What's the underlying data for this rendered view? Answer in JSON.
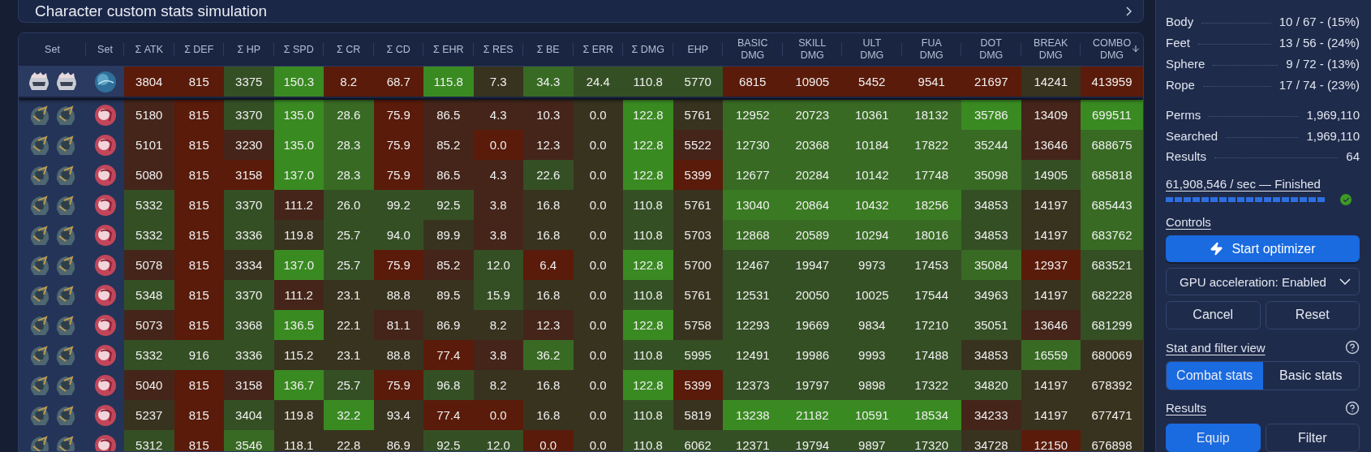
{
  "title_card": {
    "title": "Character custom stats simulation"
  },
  "table": {
    "set_columns": [
      {
        "label": "Set"
      },
      {
        "label": "Set"
      }
    ],
    "columns": [
      {
        "label": "Σ ATK",
        "kind": "stat"
      },
      {
        "label": "Σ DEF",
        "kind": "stat"
      },
      {
        "label": "Σ HP",
        "kind": "stat"
      },
      {
        "label": "Σ SPD",
        "kind": "stat"
      },
      {
        "label": "Σ CR",
        "kind": "stat"
      },
      {
        "label": "Σ CD",
        "kind": "stat"
      },
      {
        "label": "Σ EHR",
        "kind": "stat"
      },
      {
        "label": "Σ RES",
        "kind": "stat"
      },
      {
        "label": "Σ BE",
        "kind": "stat"
      },
      {
        "label": "Σ ERR",
        "kind": "stat"
      },
      {
        "label": "Σ DMG",
        "kind": "stat"
      },
      {
        "label": "EHP",
        "kind": "stat"
      },
      {
        "label": "BASIC DMG",
        "kind": "dmg"
      },
      {
        "label": "SKILL DMG",
        "kind": "dmg"
      },
      {
        "label": "ULT DMG",
        "kind": "dmg"
      },
      {
        "label": "FUA DMG",
        "kind": "dmg"
      },
      {
        "label": "DOT DMG",
        "kind": "dmg"
      },
      {
        "label": "BREAK DMG",
        "kind": "dmg"
      },
      {
        "label": "COMBO DMG",
        "kind": "sorted"
      }
    ],
    "rows": [
      {
        "pinned": true,
        "sets": [
          {
            "kind": "silver-helm"
          },
          {
            "kind": "silver-helm"
          },
          {
            "kind": "blue-orb"
          }
        ],
        "cells": [
          {
            "text": "3804",
            "color": "#5a1b0a"
          },
          {
            "text": "815",
            "color": "#5a1b0a"
          },
          {
            "text": "3375",
            "color": "#354f25"
          },
          {
            "text": "150.3",
            "color": "#3a8a22"
          },
          {
            "text": "8.2",
            "color": "#5a1b0a"
          },
          {
            "text": "68.7",
            "color": "#5a1b0a"
          },
          {
            "text": "115.8",
            "color": "#3a8a22"
          },
          {
            "text": "7.3",
            "color": "#38331f"
          },
          {
            "text": "34.3",
            "color": "#386a24"
          },
          {
            "text": "24.4",
            "color": "#354f25"
          },
          {
            "text": "110.8",
            "color": "#354f25"
          },
          {
            "text": "5770",
            "color": "#354f25"
          },
          {
            "text": "6815",
            "color": "#5a1b0a"
          },
          {
            "text": "10905",
            "color": "#5a1b0a"
          },
          {
            "text": "5452",
            "color": "#5a1b0a"
          },
          {
            "text": "9541",
            "color": "#5a1b0a"
          },
          {
            "text": "21697",
            "color": "#5a1b0a"
          },
          {
            "text": "14241",
            "color": "#38331f"
          },
          {
            "text": "413959",
            "color": "#5a1b0a"
          }
        ]
      },
      {
        "pinned": false,
        "sets": [
          {
            "kind": "dark-helm"
          },
          {
            "kind": "dark-helm"
          },
          {
            "kind": "red-orb"
          }
        ],
        "cells": [
          {
            "text": "5180",
            "color": "#45251a"
          },
          {
            "text": "815",
            "color": "#5a1b0a"
          },
          {
            "text": "3370",
            "color": "#354f25"
          },
          {
            "text": "135.0",
            "color": "#3a8a22"
          },
          {
            "text": "28.6",
            "color": "#386a24"
          },
          {
            "text": "75.9",
            "color": "#5a1b0a"
          },
          {
            "text": "86.5",
            "color": "#45251a"
          },
          {
            "text": "4.3",
            "color": "#45251a"
          },
          {
            "text": "10.3",
            "color": "#45251a"
          },
          {
            "text": "0.0",
            "color": "#38331f"
          },
          {
            "text": "122.8",
            "color": "#3a8a22"
          },
          {
            "text": "5761",
            "color": "#38331f"
          },
          {
            "text": "12952",
            "color": "#386a24"
          },
          {
            "text": "20723",
            "color": "#386a24"
          },
          {
            "text": "10361",
            "color": "#386a24"
          },
          {
            "text": "18132",
            "color": "#386a24"
          },
          {
            "text": "35786",
            "color": "#3a8a22"
          },
          {
            "text": "13409",
            "color": "#45251a"
          },
          {
            "text": "699511",
            "color": "#3a8a22"
          }
        ]
      },
      {
        "pinned": false,
        "sets": [
          {
            "kind": "dark-helm"
          },
          {
            "kind": "dark-helm"
          },
          {
            "kind": "red-orb"
          }
        ],
        "cells": [
          {
            "text": "5101",
            "color": "#45251a"
          },
          {
            "text": "815",
            "color": "#5a1b0a"
          },
          {
            "text": "3230",
            "color": "#45251a"
          },
          {
            "text": "135.0",
            "color": "#3a8a22"
          },
          {
            "text": "28.3",
            "color": "#386a24"
          },
          {
            "text": "75.9",
            "color": "#5a1b0a"
          },
          {
            "text": "85.2",
            "color": "#45251a"
          },
          {
            "text": "0.0",
            "color": "#5a1b0a"
          },
          {
            "text": "12.3",
            "color": "#45251a"
          },
          {
            "text": "0.0",
            "color": "#38331f"
          },
          {
            "text": "122.8",
            "color": "#3a8a22"
          },
          {
            "text": "5522",
            "color": "#45251a"
          },
          {
            "text": "12730",
            "color": "#386a24"
          },
          {
            "text": "20368",
            "color": "#386a24"
          },
          {
            "text": "10184",
            "color": "#386a24"
          },
          {
            "text": "17822",
            "color": "#386a24"
          },
          {
            "text": "35244",
            "color": "#386a24"
          },
          {
            "text": "13646",
            "color": "#45251a"
          },
          {
            "text": "688675",
            "color": "#386a24"
          }
        ]
      },
      {
        "pinned": false,
        "sets": [
          {
            "kind": "dark-helm"
          },
          {
            "kind": "dark-helm"
          },
          {
            "kind": "red-orb"
          }
        ],
        "cells": [
          {
            "text": "5080",
            "color": "#45251a"
          },
          {
            "text": "815",
            "color": "#5a1b0a"
          },
          {
            "text": "3158",
            "color": "#5a1b0a"
          },
          {
            "text": "137.0",
            "color": "#3a8a22"
          },
          {
            "text": "28.3",
            "color": "#386a24"
          },
          {
            "text": "75.9",
            "color": "#5a1b0a"
          },
          {
            "text": "86.5",
            "color": "#45251a"
          },
          {
            "text": "4.3",
            "color": "#45251a"
          },
          {
            "text": "22.6",
            "color": "#354f25"
          },
          {
            "text": "0.0",
            "color": "#38331f"
          },
          {
            "text": "122.8",
            "color": "#3a8a22"
          },
          {
            "text": "5399",
            "color": "#5a1b0a"
          },
          {
            "text": "12677",
            "color": "#386a24"
          },
          {
            "text": "20284",
            "color": "#386a24"
          },
          {
            "text": "10142",
            "color": "#386a24"
          },
          {
            "text": "17748",
            "color": "#386a24"
          },
          {
            "text": "35098",
            "color": "#386a24"
          },
          {
            "text": "14905",
            "color": "#354f25"
          },
          {
            "text": "685818",
            "color": "#386a24"
          }
        ]
      },
      {
        "pinned": false,
        "sets": [
          {
            "kind": "dark-helm"
          },
          {
            "kind": "dark-helm"
          },
          {
            "kind": "red-orb"
          }
        ],
        "cells": [
          {
            "text": "5332",
            "color": "#354f25"
          },
          {
            "text": "815",
            "color": "#5a1b0a"
          },
          {
            "text": "3370",
            "color": "#354f25"
          },
          {
            "text": "111.2",
            "color": "#45251a"
          },
          {
            "text": "26.0",
            "color": "#354f25"
          },
          {
            "text": "99.2",
            "color": "#354f25"
          },
          {
            "text": "92.5",
            "color": "#354f25"
          },
          {
            "text": "3.8",
            "color": "#45251a"
          },
          {
            "text": "16.8",
            "color": "#38331f"
          },
          {
            "text": "0.0",
            "color": "#38331f"
          },
          {
            "text": "110.8",
            "color": "#354f25"
          },
          {
            "text": "5761",
            "color": "#38331f"
          },
          {
            "text": "13040",
            "color": "#3a7a22"
          },
          {
            "text": "20864",
            "color": "#3a7a22"
          },
          {
            "text": "10432",
            "color": "#3a7a22"
          },
          {
            "text": "18256",
            "color": "#3a7a22"
          },
          {
            "text": "34853",
            "color": "#354f25"
          },
          {
            "text": "14197",
            "color": "#38331f"
          },
          {
            "text": "685443",
            "color": "#386a24"
          }
        ]
      },
      {
        "pinned": false,
        "sets": [
          {
            "kind": "dark-helm"
          },
          {
            "kind": "dark-helm"
          },
          {
            "kind": "red-orb"
          }
        ],
        "cells": [
          {
            "text": "5332",
            "color": "#354f25"
          },
          {
            "text": "815",
            "color": "#5a1b0a"
          },
          {
            "text": "3336",
            "color": "#354f25"
          },
          {
            "text": "119.8",
            "color": "#38331f"
          },
          {
            "text": "25.7",
            "color": "#354f25"
          },
          {
            "text": "94.0",
            "color": "#354f25"
          },
          {
            "text": "89.9",
            "color": "#38331f"
          },
          {
            "text": "3.8",
            "color": "#45251a"
          },
          {
            "text": "16.8",
            "color": "#38331f"
          },
          {
            "text": "0.0",
            "color": "#38331f"
          },
          {
            "text": "110.8",
            "color": "#354f25"
          },
          {
            "text": "5703",
            "color": "#38331f"
          },
          {
            "text": "12868",
            "color": "#386a24"
          },
          {
            "text": "20589",
            "color": "#386a24"
          },
          {
            "text": "10294",
            "color": "#386a24"
          },
          {
            "text": "18016",
            "color": "#386a24"
          },
          {
            "text": "34853",
            "color": "#354f25"
          },
          {
            "text": "14197",
            "color": "#38331f"
          },
          {
            "text": "683762",
            "color": "#386a24"
          }
        ]
      },
      {
        "pinned": false,
        "sets": [
          {
            "kind": "dark-helm"
          },
          {
            "kind": "dark-helm"
          },
          {
            "kind": "red-orb"
          }
        ],
        "cells": [
          {
            "text": "5078",
            "color": "#45251a"
          },
          {
            "text": "815",
            "color": "#5a1b0a"
          },
          {
            "text": "3334",
            "color": "#38331f"
          },
          {
            "text": "137.0",
            "color": "#3a8a22"
          },
          {
            "text": "25.7",
            "color": "#354f25"
          },
          {
            "text": "75.9",
            "color": "#5a1b0a"
          },
          {
            "text": "85.2",
            "color": "#45251a"
          },
          {
            "text": "12.0",
            "color": "#354f25"
          },
          {
            "text": "6.4",
            "color": "#5a1b0a"
          },
          {
            "text": "0.0",
            "color": "#38331f"
          },
          {
            "text": "122.8",
            "color": "#3a8a22"
          },
          {
            "text": "5700",
            "color": "#38331f"
          },
          {
            "text": "12467",
            "color": "#354f25"
          },
          {
            "text": "19947",
            "color": "#354f25"
          },
          {
            "text": "9973",
            "color": "#354f25"
          },
          {
            "text": "17453",
            "color": "#354f25"
          },
          {
            "text": "35084",
            "color": "#386a24"
          },
          {
            "text": "12937",
            "color": "#5a1b0a"
          },
          {
            "text": "683521",
            "color": "#354f25"
          }
        ]
      },
      {
        "pinned": false,
        "sets": [
          {
            "kind": "dark-helm"
          },
          {
            "kind": "dark-helm"
          },
          {
            "kind": "red-orb"
          }
        ],
        "cells": [
          {
            "text": "5348",
            "color": "#354f25"
          },
          {
            "text": "815",
            "color": "#5a1b0a"
          },
          {
            "text": "3370",
            "color": "#354f25"
          },
          {
            "text": "111.2",
            "color": "#45251a"
          },
          {
            "text": "23.1",
            "color": "#38331f"
          },
          {
            "text": "88.8",
            "color": "#38331f"
          },
          {
            "text": "89.5",
            "color": "#38331f"
          },
          {
            "text": "15.9",
            "color": "#354f25"
          },
          {
            "text": "16.8",
            "color": "#38331f"
          },
          {
            "text": "0.0",
            "color": "#38331f"
          },
          {
            "text": "110.8",
            "color": "#354f25"
          },
          {
            "text": "5761",
            "color": "#38331f"
          },
          {
            "text": "12531",
            "color": "#354f25"
          },
          {
            "text": "20050",
            "color": "#354f25"
          },
          {
            "text": "10025",
            "color": "#354f25"
          },
          {
            "text": "17544",
            "color": "#354f25"
          },
          {
            "text": "34963",
            "color": "#354f25"
          },
          {
            "text": "14197",
            "color": "#38331f"
          },
          {
            "text": "682228",
            "color": "#354f25"
          }
        ]
      },
      {
        "pinned": false,
        "sets": [
          {
            "kind": "dark-helm"
          },
          {
            "kind": "dark-helm"
          },
          {
            "kind": "red-orb"
          }
        ],
        "cells": [
          {
            "text": "5073",
            "color": "#45251a"
          },
          {
            "text": "815",
            "color": "#5a1b0a"
          },
          {
            "text": "3368",
            "color": "#354f25"
          },
          {
            "text": "136.5",
            "color": "#3a8a22"
          },
          {
            "text": "22.1",
            "color": "#38331f"
          },
          {
            "text": "81.1",
            "color": "#45251a"
          },
          {
            "text": "86.9",
            "color": "#38331f"
          },
          {
            "text": "8.2",
            "color": "#38331f"
          },
          {
            "text": "12.3",
            "color": "#45251a"
          },
          {
            "text": "0.0",
            "color": "#38331f"
          },
          {
            "text": "122.8",
            "color": "#3a8a22"
          },
          {
            "text": "5758",
            "color": "#38331f"
          },
          {
            "text": "12293",
            "color": "#354f25"
          },
          {
            "text": "19669",
            "color": "#354f25"
          },
          {
            "text": "9834",
            "color": "#354f25"
          },
          {
            "text": "17210",
            "color": "#354f25"
          },
          {
            "text": "35051",
            "color": "#354f25"
          },
          {
            "text": "13646",
            "color": "#45251a"
          },
          {
            "text": "681299",
            "color": "#354f25"
          }
        ]
      },
      {
        "pinned": false,
        "sets": [
          {
            "kind": "dark-helm"
          },
          {
            "kind": "dark-helm"
          },
          {
            "kind": "red-orb"
          }
        ],
        "cells": [
          {
            "text": "5332",
            "color": "#354f25"
          },
          {
            "text": "916",
            "color": "#354f25"
          },
          {
            "text": "3336",
            "color": "#354f25"
          },
          {
            "text": "115.2",
            "color": "#38331f"
          },
          {
            "text": "23.1",
            "color": "#38331f"
          },
          {
            "text": "88.8",
            "color": "#38331f"
          },
          {
            "text": "77.4",
            "color": "#5a1b0a"
          },
          {
            "text": "3.8",
            "color": "#45251a"
          },
          {
            "text": "36.2",
            "color": "#386a24"
          },
          {
            "text": "0.0",
            "color": "#38331f"
          },
          {
            "text": "110.8",
            "color": "#354f25"
          },
          {
            "text": "5995",
            "color": "#354f25"
          },
          {
            "text": "12491",
            "color": "#354f25"
          },
          {
            "text": "19986",
            "color": "#354f25"
          },
          {
            "text": "9993",
            "color": "#354f25"
          },
          {
            "text": "17488",
            "color": "#354f25"
          },
          {
            "text": "34853",
            "color": "#38331f"
          },
          {
            "text": "16559",
            "color": "#386a24"
          },
          {
            "text": "680069",
            "color": "#38331f"
          }
        ]
      },
      {
        "pinned": false,
        "sets": [
          {
            "kind": "dark-helm"
          },
          {
            "kind": "dark-helm"
          },
          {
            "kind": "red-orb"
          }
        ],
        "cells": [
          {
            "text": "5040",
            "color": "#45251a"
          },
          {
            "text": "815",
            "color": "#5a1b0a"
          },
          {
            "text": "3158",
            "color": "#45251a"
          },
          {
            "text": "136.7",
            "color": "#3a8a22"
          },
          {
            "text": "25.7",
            "color": "#354f25"
          },
          {
            "text": "75.9",
            "color": "#5a1b0a"
          },
          {
            "text": "96.8",
            "color": "#354f25"
          },
          {
            "text": "8.2",
            "color": "#38331f"
          },
          {
            "text": "16.8",
            "color": "#38331f"
          },
          {
            "text": "0.0",
            "color": "#38331f"
          },
          {
            "text": "122.8",
            "color": "#3a8a22"
          },
          {
            "text": "5399",
            "color": "#5a1b0a"
          },
          {
            "text": "12373",
            "color": "#354f25"
          },
          {
            "text": "19797",
            "color": "#354f25"
          },
          {
            "text": "9898",
            "color": "#354f25"
          },
          {
            "text": "17322",
            "color": "#354f25"
          },
          {
            "text": "34820",
            "color": "#354f25"
          },
          {
            "text": "14197",
            "color": "#38331f"
          },
          {
            "text": "678392",
            "color": "#38331f"
          }
        ]
      },
      {
        "pinned": false,
        "sets": [
          {
            "kind": "dark-helm"
          },
          {
            "kind": "dark-helm"
          },
          {
            "kind": "red-orb"
          }
        ],
        "cells": [
          {
            "text": "5237",
            "color": "#38331f"
          },
          {
            "text": "815",
            "color": "#5a1b0a"
          },
          {
            "text": "3404",
            "color": "#354f25"
          },
          {
            "text": "119.8",
            "color": "#38331f"
          },
          {
            "text": "32.2",
            "color": "#3a8a22"
          },
          {
            "text": "93.4",
            "color": "#38331f"
          },
          {
            "text": "77.4",
            "color": "#5a1b0a"
          },
          {
            "text": "0.0",
            "color": "#5a1b0a"
          },
          {
            "text": "16.8",
            "color": "#38331f"
          },
          {
            "text": "0.0",
            "color": "#38331f"
          },
          {
            "text": "110.8",
            "color": "#354f25"
          },
          {
            "text": "5819",
            "color": "#38331f"
          },
          {
            "text": "13238",
            "color": "#3a8a22"
          },
          {
            "text": "21182",
            "color": "#3a8a22"
          },
          {
            "text": "10591",
            "color": "#3a8a22"
          },
          {
            "text": "18534",
            "color": "#3a8a22"
          },
          {
            "text": "34233",
            "color": "#45251a"
          },
          {
            "text": "14197",
            "color": "#38331f"
          },
          {
            "text": "677471",
            "color": "#38331f"
          }
        ]
      },
      {
        "pinned": false,
        "sets": [
          {
            "kind": "dark-helm"
          },
          {
            "kind": "dark-helm"
          },
          {
            "kind": "red-orb"
          }
        ],
        "cells": [
          {
            "text": "5312",
            "color": "#354f25"
          },
          {
            "text": "815",
            "color": "#5a1b0a"
          },
          {
            "text": "3546",
            "color": "#386a24"
          },
          {
            "text": "118.1",
            "color": "#38331f"
          },
          {
            "text": "22.8",
            "color": "#38331f"
          },
          {
            "text": "86.9",
            "color": "#38331f"
          },
          {
            "text": "92.5",
            "color": "#354f25"
          },
          {
            "text": "12.0",
            "color": "#354f25"
          },
          {
            "text": "0.0",
            "color": "#5a1b0a"
          },
          {
            "text": "0.0",
            "color": "#38331f"
          },
          {
            "text": "110.8",
            "color": "#354f25"
          },
          {
            "text": "6062",
            "color": "#354f25"
          },
          {
            "text": "12371",
            "color": "#354f25"
          },
          {
            "text": "19794",
            "color": "#354f25"
          },
          {
            "text": "9897",
            "color": "#354f25"
          },
          {
            "text": "17320",
            "color": "#354f25"
          },
          {
            "text": "34728",
            "color": "#38331f"
          },
          {
            "text": "12150",
            "color": "#5a1b0a"
          },
          {
            "text": "676898",
            "color": "#38331f"
          }
        ]
      }
    ]
  },
  "side_panel": {
    "slots": [
      {
        "label": "Body",
        "value": "10 / 67 - (15%)"
      },
      {
        "label": "Feet",
        "value": "13 / 56 - (24%)"
      },
      {
        "label": "Sphere",
        "value": "9 / 72 - (13%)"
      },
      {
        "label": "Rope",
        "value": "17 / 74 - (23%)"
      }
    ],
    "stats": [
      {
        "label": "Perms",
        "value": "1,969,110"
      },
      {
        "label": "Searched",
        "value": "1,969,110"
      },
      {
        "label": "Results",
        "value": "64"
      }
    ],
    "speed": "61,908,546 / sec — Finished",
    "progress": {
      "level": 1,
      "done": true
    },
    "controls_title": "Controls",
    "start_button": "Start optimizer",
    "gpu_select": {
      "value": "GPU acceleration: Enabled"
    },
    "actions": [
      "Cancel",
      "Reset"
    ],
    "view_title": "Stat and filter view",
    "view_tabs": [
      {
        "label": "Combat stats",
        "selected": true
      },
      {
        "label": "Basic stats",
        "selected": false
      }
    ],
    "results_title": "Results",
    "result_buttons": [
      {
        "label": "Equip",
        "kind": "primary"
      },
      {
        "label": "Filter",
        "kind": "default"
      }
    ]
  }
}
